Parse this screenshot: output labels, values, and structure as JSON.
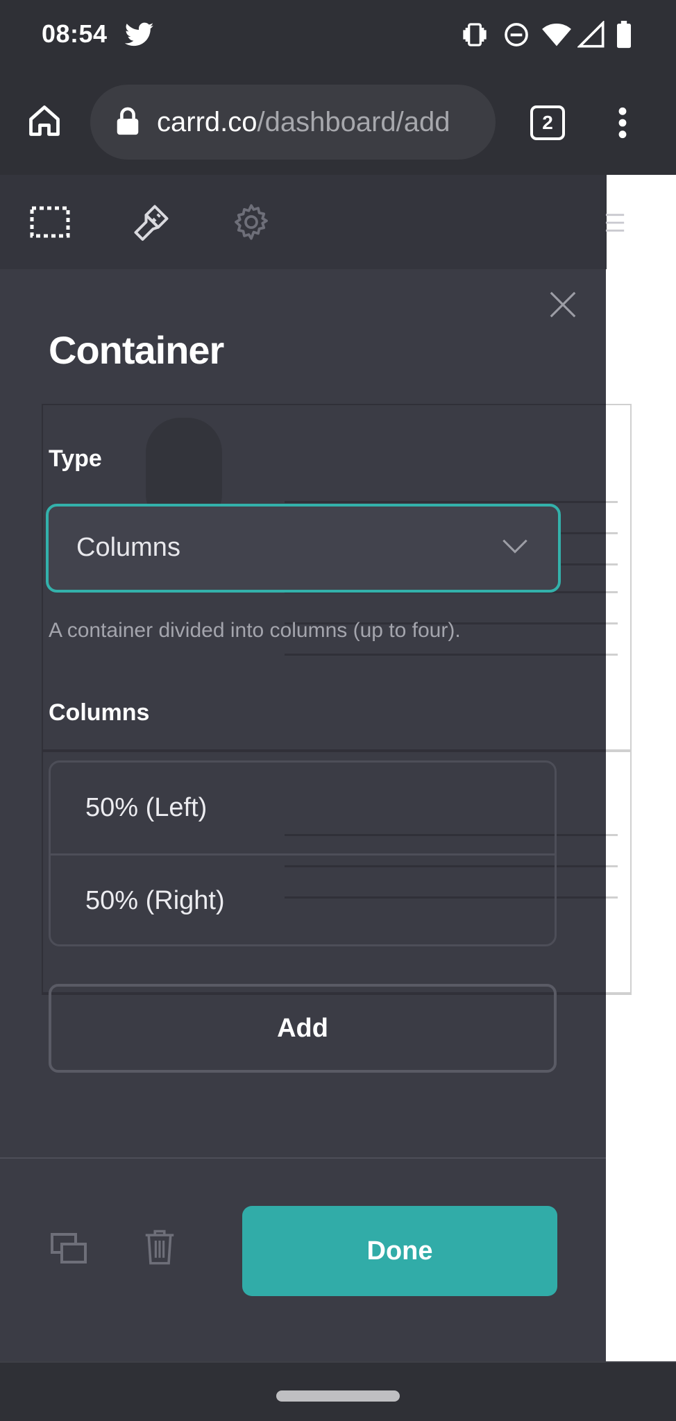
{
  "status_bar": {
    "time": "08:54"
  },
  "browser": {
    "url_domain": "carrd.co",
    "url_path": "/dashboard/add",
    "tab_count": "2"
  },
  "panel": {
    "title": "Container",
    "type_label": "Type",
    "type_value": "Columns",
    "type_help": "A container divided into columns (up to four).",
    "columns_label": "Columns",
    "columns": [
      {
        "label": "50% (Left)"
      },
      {
        "label": "50% (Right)"
      }
    ],
    "add_label": "Add",
    "done_label": "Done"
  },
  "colors": {
    "accent": "#31aca8",
    "panel_bg": "#3b3c45",
    "system_bg": "#2f3036"
  },
  "icons": [
    "twitter-icon",
    "vibrate-icon",
    "do-not-disturb-icon",
    "wifi-icon",
    "signal-icon",
    "battery-icon",
    "home-icon",
    "lock-icon",
    "tab-count-icon",
    "more-icon",
    "select-icon",
    "brush-icon",
    "gear-icon",
    "menu-icon",
    "close-icon",
    "chevron-down-icon",
    "duplicate-icon",
    "trash-icon"
  ]
}
